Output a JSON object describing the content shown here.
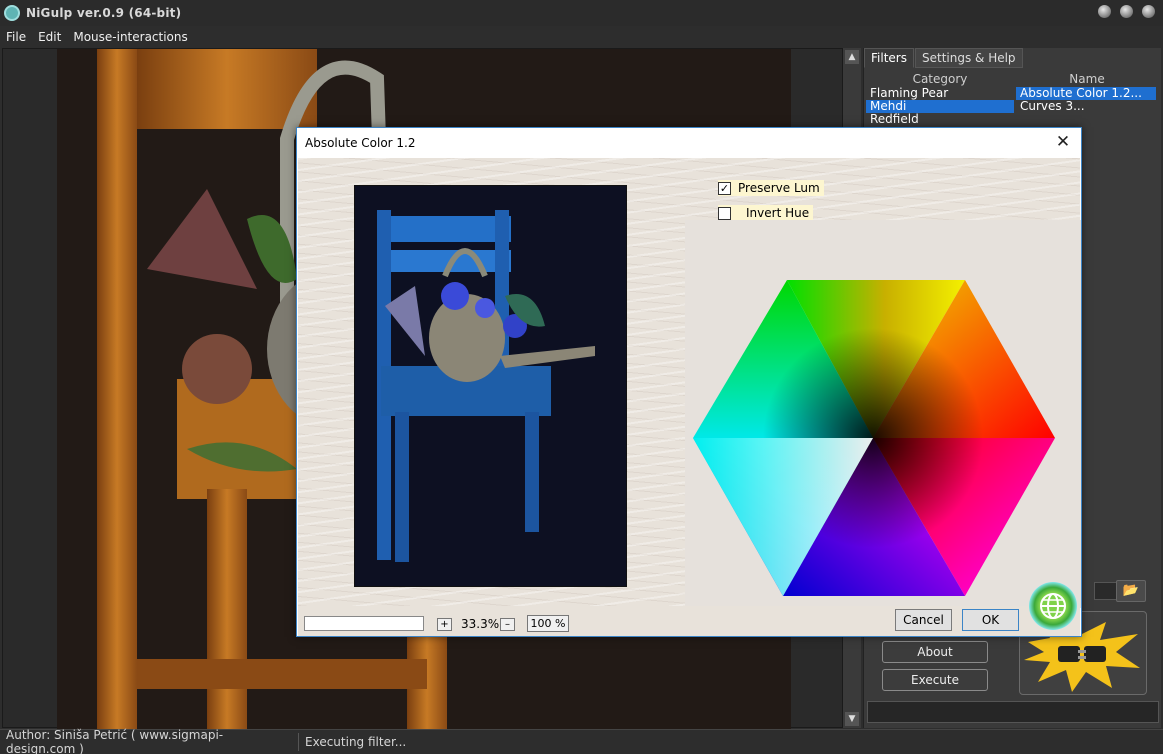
{
  "window": {
    "title": "NiGulp ver.0.9 (64-bit)"
  },
  "menu": {
    "items": [
      "File",
      "Edit",
      "Mouse-interactions"
    ]
  },
  "panel": {
    "tabs": [
      "Filters",
      "Settings & Help"
    ],
    "columns": {
      "category": "Category",
      "name": "Name"
    },
    "categories": [
      "Flaming Pear",
      "Mehdi",
      "Redfield"
    ],
    "names": [
      "Absolute Color 1.2...",
      "Curves 3..."
    ],
    "selected_category": "Mehdi",
    "selected_name": "Absolute Color 1.2...",
    "about_label": "About",
    "execute_label": "Execute",
    "folder_icon": "folder-open-icon"
  },
  "status": {
    "author": "Author:  Siniša Petrić ( www.sigmapi-design.com )",
    "message": "Executing filter..."
  },
  "dialog": {
    "title": "Absolute Color 1.2",
    "options": {
      "preserve_lum": {
        "label": "Preserve Lum",
        "checked": true
      },
      "invert_hue": {
        "label": "Invert Hue",
        "checked": false
      }
    },
    "zoom": {
      "plus": "+",
      "value": "33.3%",
      "minus": "–",
      "full": "100 %"
    },
    "cancel_label": "Cancel",
    "ok_label": "OK",
    "close_glyph": "✕"
  }
}
